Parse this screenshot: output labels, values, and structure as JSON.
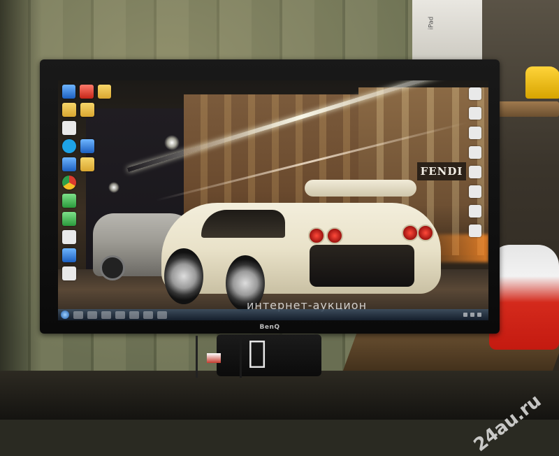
{
  "photo": {
    "watermark_corner": "24au.ru",
    "room": {
      "box_label": "iPad"
    }
  },
  "monitor": {
    "brand": "BenQ",
    "screen": {
      "wallpaper": {
        "store_sign": "FENDI",
        "overlay_watermark": "интернет-аукцион"
      },
      "taskbar": {
        "clock_time": "",
        "clock_date": ""
      }
    }
  },
  "stand_logo": "apple-logo-icon",
  "colors": {
    "bezel": "#111111",
    "car": "#eee7cf",
    "taskbar": "#1e2d3e"
  }
}
